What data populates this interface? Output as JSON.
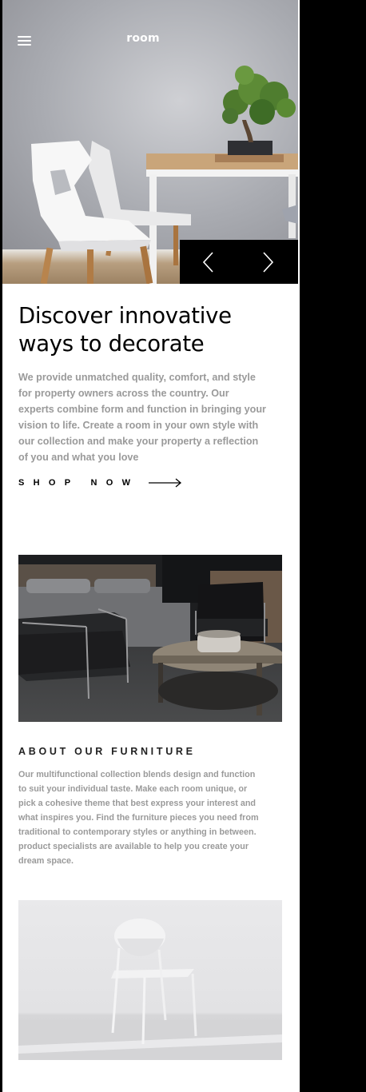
{
  "header": {
    "logo": "room",
    "menu_icon": "hamburger-icon"
  },
  "hero": {
    "prev_icon": "chevron-left-icon",
    "next_icon": "chevron-right-icon"
  },
  "intro": {
    "headline_line1": "Discover innovative",
    "headline_line2": "ways to decorate",
    "text": "We provide unmatched quality, comfort, and style for property owners across the country. Our experts combine form and function in bringing your vision to life. Create a room in your own style with our collection and make your property a reflection of you and what you love",
    "cta_label": "SHOP NOW",
    "cta_icon": "arrow-right-icon"
  },
  "about": {
    "title": "ABOUT OUR FURNITURE",
    "text": "Our multifunctional collection blends design and function to suit your individual taste. Make each room unique, or pick a cohesive theme that best express your interest and what inspires you. Find the furniture pieces you need from traditional to contemporary styles or anything in between. product specialists are available to help you create your dream space."
  },
  "colors": {
    "accent": "#000000",
    "muted_text": "#9a9a9a",
    "background": "#ffffff"
  }
}
